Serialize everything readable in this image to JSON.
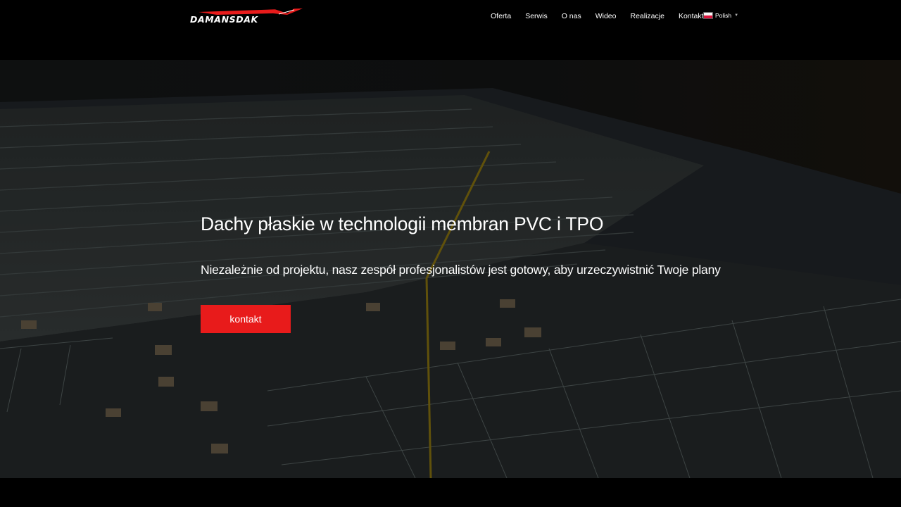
{
  "brand": {
    "logo_text": "DAMANSDAK",
    "accent_color": "#e81b1b"
  },
  "nav": {
    "items": [
      {
        "label": "Oferta"
      },
      {
        "label": "Serwis"
      },
      {
        "label": "O nas"
      },
      {
        "label": "Wideo"
      },
      {
        "label": "Realizacje"
      },
      {
        "label": "Kontakt"
      }
    ],
    "language": {
      "label": "Polish",
      "flag_icon": "poland-flag-icon",
      "caret_icon": "chevron-down-icon"
    }
  },
  "hero": {
    "title": "Dachy płaskie w technologii membran PVC i TPO",
    "subtitle": "Niezależnie od projektu, nasz zespół profesjonalistów jest gotowy, aby urzeczywistnić Twoje plany",
    "cta_label": "kontakt",
    "background": "aerial-construction-site-image"
  }
}
